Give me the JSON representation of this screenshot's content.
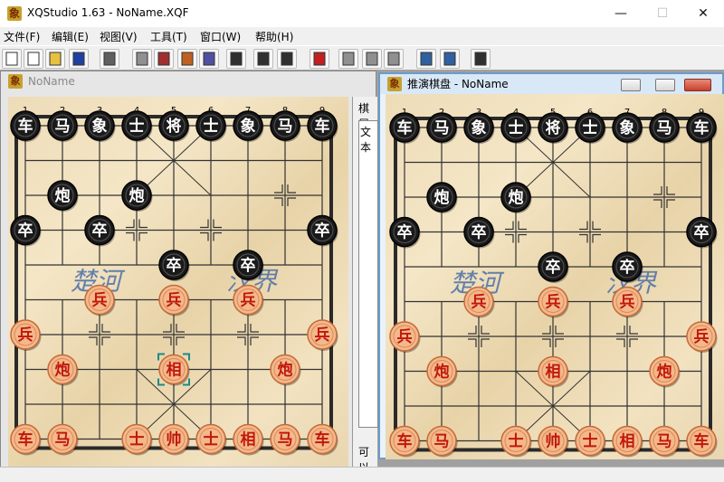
{
  "window": {
    "title": "XQStudio 1.63 - NoName.XQF",
    "icon_glyph": "象"
  },
  "window_controls": {
    "minimize": "—",
    "maximize": "☐",
    "close": "✕"
  },
  "menu": [
    "文件(F)",
    "编辑(E)",
    "视图(V)",
    "工具(T)",
    "窗口(W)",
    "帮助(H)"
  ],
  "toolbar_icons": [
    "new-file-icon",
    "open-icon",
    "folder-open-icon",
    "save-icon",
    "print-icon",
    "board-icon",
    "copy-board-icon",
    "paste-board-icon",
    "setup-icon",
    "swap-icon",
    "flip-vertical-icon",
    "flip-horizontal-icon",
    "step-icon",
    "cut-icon",
    "copy-icon",
    "paste-icon",
    "export-icon",
    "import-icon",
    "preview-icon"
  ],
  "left_window": {
    "title": "NoName"
  },
  "right_window": {
    "title": "推演棋盘 - NoName"
  },
  "side_panel": {
    "label1": "棋居",
    "label2": "文本",
    "label3": "可以"
  },
  "board": {
    "files_labels": [
      "1",
      "2",
      "3",
      "4",
      "5",
      "6",
      "7",
      "8",
      "9"
    ],
    "river": {
      "left": "楚河",
      "right": "汉界"
    },
    "pieces": [
      {
        "f": 1,
        "r": 0,
        "text": "车",
        "side": "black"
      },
      {
        "f": 2,
        "r": 0,
        "text": "马",
        "side": "black"
      },
      {
        "f": 3,
        "r": 0,
        "text": "象",
        "side": "black"
      },
      {
        "f": 4,
        "r": 0,
        "text": "士",
        "side": "black"
      },
      {
        "f": 5,
        "r": 0,
        "text": "将",
        "side": "black"
      },
      {
        "f": 6,
        "r": 0,
        "text": "士",
        "side": "black"
      },
      {
        "f": 7,
        "r": 0,
        "text": "象",
        "side": "black"
      },
      {
        "f": 8,
        "r": 0,
        "text": "马",
        "side": "black"
      },
      {
        "f": 9,
        "r": 0,
        "text": "车",
        "side": "black"
      },
      {
        "f": 2,
        "r": 2,
        "text": "炮",
        "side": "black"
      },
      {
        "f": 4,
        "r": 2,
        "text": "炮",
        "side": "black"
      },
      {
        "f": 1,
        "r": 3,
        "text": "卒",
        "side": "black"
      },
      {
        "f": 3,
        "r": 3,
        "text": "卒",
        "side": "black"
      },
      {
        "f": 9,
        "r": 3,
        "text": "卒",
        "side": "black"
      },
      {
        "f": 5,
        "r": 4,
        "text": "卒",
        "side": "black"
      },
      {
        "f": 7,
        "r": 4,
        "text": "卒",
        "side": "black"
      },
      {
        "f": 3,
        "r": 5,
        "text": "兵",
        "side": "red"
      },
      {
        "f": 5,
        "r": 5,
        "text": "兵",
        "side": "red"
      },
      {
        "f": 7,
        "r": 5,
        "text": "兵",
        "side": "red"
      },
      {
        "f": 1,
        "r": 6,
        "text": "兵",
        "side": "red"
      },
      {
        "f": 9,
        "r": 6,
        "text": "兵",
        "side": "red"
      },
      {
        "f": 2,
        "r": 7,
        "text": "炮",
        "side": "red"
      },
      {
        "f": 5,
        "r": 7,
        "text": "相",
        "side": "red"
      },
      {
        "f": 8,
        "r": 7,
        "text": "炮",
        "side": "red"
      },
      {
        "f": 1,
        "r": 9,
        "text": "车",
        "side": "red"
      },
      {
        "f": 2,
        "r": 9,
        "text": "马",
        "side": "red"
      },
      {
        "f": 4,
        "r": 9,
        "text": "士",
        "side": "red"
      },
      {
        "f": 5,
        "r": 9,
        "text": "帅",
        "side": "red"
      },
      {
        "f": 6,
        "r": 9,
        "text": "士",
        "side": "red"
      },
      {
        "f": 7,
        "r": 9,
        "text": "相",
        "side": "red"
      },
      {
        "f": 8,
        "r": 9,
        "text": "马",
        "side": "red"
      },
      {
        "f": 9,
        "r": 9,
        "text": "车",
        "side": "red"
      }
    ],
    "last_move_left": {
      "f": 5,
      "r": 7
    },
    "crosshair_left": [
      {
        "f": 8,
        "r": 2
      },
      {
        "f": 4,
        "r": 3
      },
      {
        "f": 6,
        "r": 3
      },
      {
        "f": 3,
        "r": 6
      },
      {
        "f": 5,
        "r": 6
      },
      {
        "f": 7,
        "r": 6
      }
    ],
    "crosshair_right": [
      {
        "f": 8,
        "r": 2
      },
      {
        "f": 4,
        "r": 3
      },
      {
        "f": 6,
        "r": 3
      },
      {
        "f": 3,
        "r": 6
      },
      {
        "f": 5,
        "r": 6
      },
      {
        "f": 7,
        "r": 6
      }
    ]
  },
  "colors": {
    "red_piece_face": "#f4b88a",
    "red_piece_text": "#c0180c",
    "black_piece_face": "#1a1a1a",
    "black_piece_text": "#ffffff",
    "river_text": "#4a6ea8",
    "accent": "#1a8a8a"
  }
}
